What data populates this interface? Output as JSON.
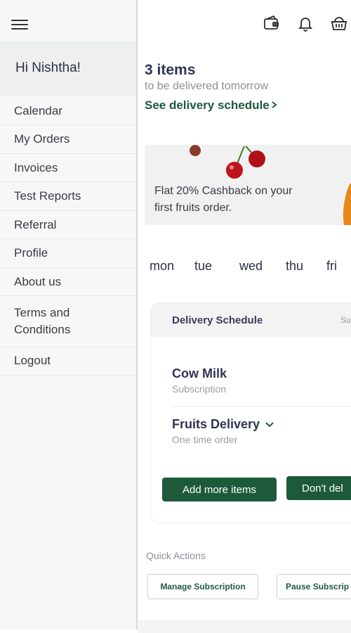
{
  "header": {
    "icons": [
      "wallet-icon",
      "bell-icon",
      "basket-icon"
    ]
  },
  "summary": {
    "count": "3 items",
    "subtitle": "to be delivered tomorrow",
    "link": "See delivery schedule"
  },
  "banner": {
    "text": "Flat 20% Cashback on your first fruits order."
  },
  "days": [
    "mon",
    "tue",
    "wed",
    "thu",
    "fri"
  ],
  "schedule": {
    "title": "Delivery Schedule",
    "right_text": "Su",
    "items": [
      {
        "name": "Cow Milk",
        "type": "Subscription"
      },
      {
        "name": "Fruits Delivery",
        "type": "One time order"
      }
    ],
    "add_button": "Add more items",
    "second_button": "Don't del"
  },
  "quick_actions": {
    "label": "Quick Actions",
    "buttons": [
      "Manage Subscription",
      "Pause Subscrip"
    ]
  },
  "drawer": {
    "greeting": "Hi Nishtha!",
    "items": [
      "Calendar",
      "My Orders",
      "Invoices",
      "Test Reports",
      "Referral",
      "Profile",
      "About us",
      "Terms and Conditions",
      "Logout"
    ]
  },
  "colors": {
    "brand_green": "#1d5a3a",
    "drawer_bg": "#f7f7f7",
    "greeting_bg": "#eef0ef"
  }
}
